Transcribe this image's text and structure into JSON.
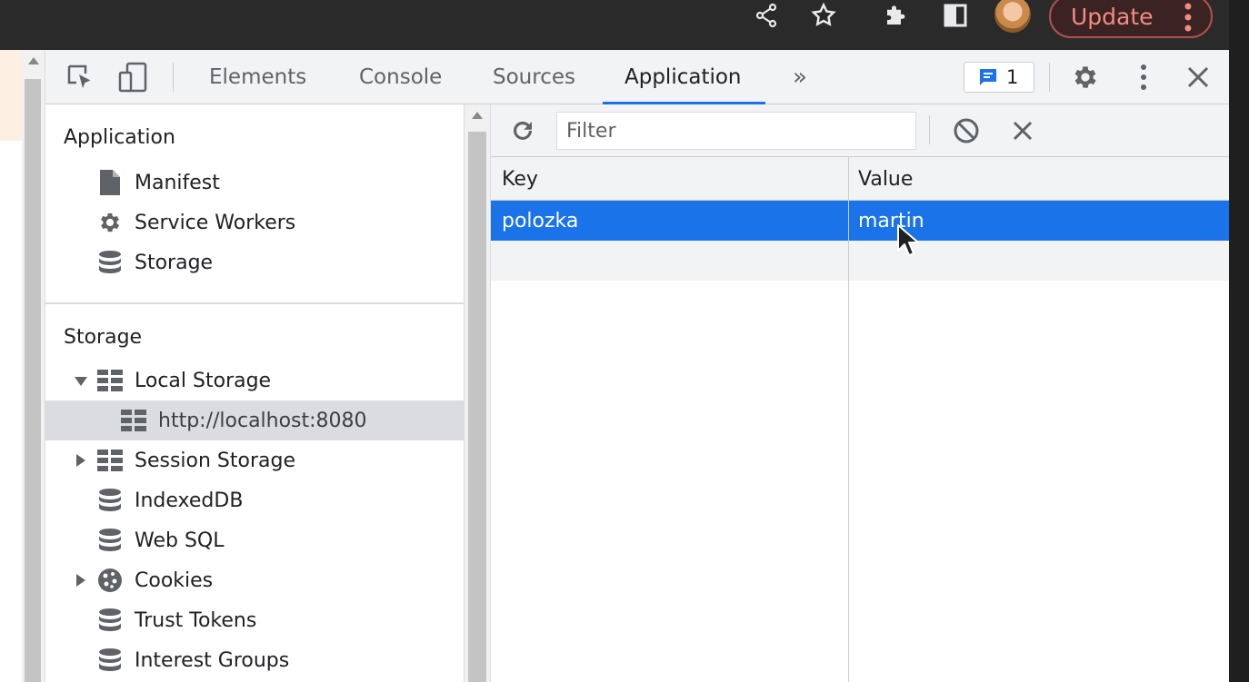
{
  "browser": {
    "update_label": "Update"
  },
  "devtools": {
    "tabs": [
      {
        "label": "Elements"
      },
      {
        "label": "Console"
      },
      {
        "label": "Sources"
      },
      {
        "label": "Application"
      }
    ],
    "active_tab": "Application",
    "issues_count": "1"
  },
  "sidebar": {
    "application_title": "Application",
    "application_items": [
      {
        "label": "Manifest",
        "icon": "file-icon"
      },
      {
        "label": "Service Workers",
        "icon": "gear-icon"
      },
      {
        "label": "Storage",
        "icon": "database-icon"
      }
    ],
    "storage_title": "Storage",
    "storage_items": [
      {
        "label": "Local Storage",
        "icon": "table-icon",
        "expanded": true
      },
      {
        "label": "http://localhost:8080",
        "icon": "table-icon",
        "selected": true
      },
      {
        "label": "Session Storage",
        "icon": "table-icon",
        "expanded": false
      },
      {
        "label": "IndexedDB",
        "icon": "database-icon"
      },
      {
        "label": "Web SQL",
        "icon": "database-icon"
      },
      {
        "label": "Cookies",
        "icon": "cookie-icon",
        "expanded": false
      },
      {
        "label": "Trust Tokens",
        "icon": "database-icon"
      },
      {
        "label": "Interest Groups",
        "icon": "database-icon"
      }
    ]
  },
  "main": {
    "filter_placeholder": "Filter",
    "columns": {
      "key": "Key",
      "value": "Value"
    },
    "rows": [
      {
        "key": "polozka",
        "value": "martin",
        "selected": true
      }
    ]
  },
  "colors": {
    "accent": "#1a73e8",
    "update_text": "#f28b82"
  }
}
